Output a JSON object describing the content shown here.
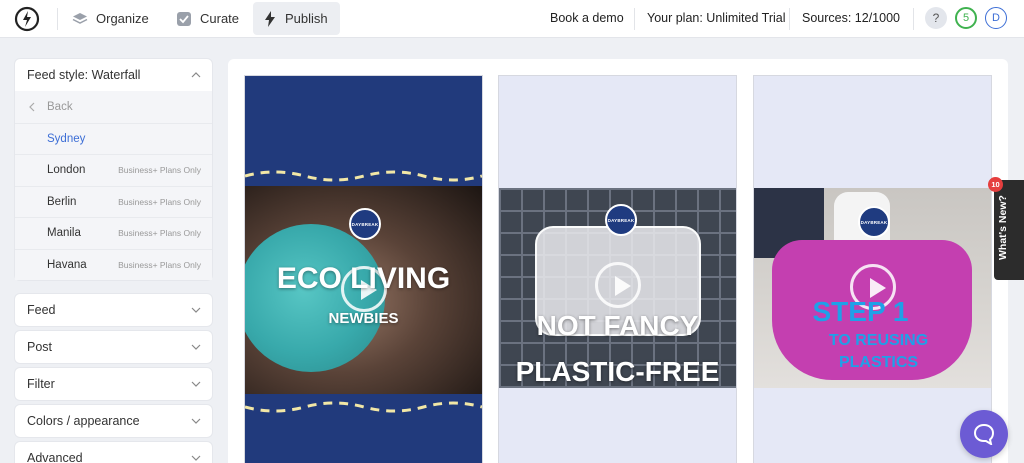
{
  "nav": {
    "organize": "Organize",
    "curate": "Curate",
    "publish": "Publish",
    "book_demo": "Book a demo",
    "plan": "Your plan: Unlimited Trial",
    "sources": "Sources: 12/1000",
    "help": "?",
    "notifications_count": "5",
    "avatar_initial": "D"
  },
  "sidebar": {
    "feed_style": {
      "label": "Feed style: Waterfall",
      "back": "Back",
      "options": [
        {
          "name": "Sydney",
          "note": "",
          "selected": true
        },
        {
          "name": "London",
          "note": "Business+ Plans Only"
        },
        {
          "name": "Berlin",
          "note": "Business+ Plans Only"
        },
        {
          "name": "Manila",
          "note": "Business+ Plans Only"
        },
        {
          "name": "Havana",
          "note": "Business+ Plans Only"
        }
      ]
    },
    "sections": [
      "Feed",
      "Post",
      "Filter",
      "Colors / appearance",
      "Advanced"
    ]
  },
  "cards": [
    {
      "brand": "DAYBREAK",
      "line1": "ECO LIVING",
      "line2": "NEWBIES"
    },
    {
      "brand": "DAYBREAK",
      "line1": "NOT FANCY",
      "line2": "PLASTIC-FREE"
    },
    {
      "brand": "DAYBREAK",
      "line1": "STEP 1",
      "line2": "TO REUSING",
      "line3": "PLASTICS"
    }
  ],
  "widgets": {
    "whats_new": "What's New?",
    "whats_new_count": "10"
  },
  "colors": {
    "accent": "#3c6ed6",
    "card_navy": "#213a7c",
    "step_blue": "#1fa0e8",
    "chat": "#6c5bd4"
  }
}
